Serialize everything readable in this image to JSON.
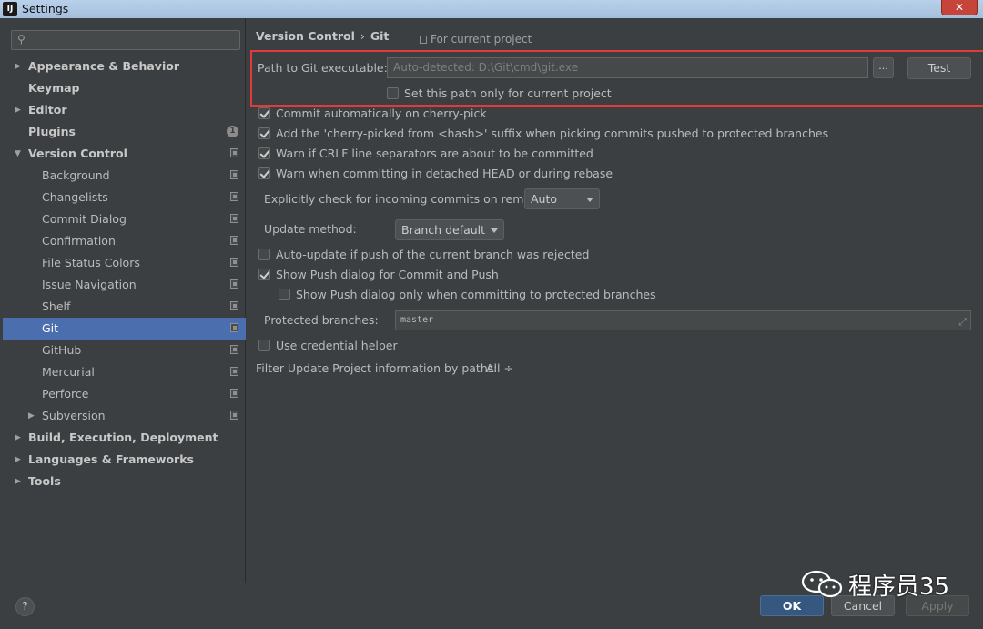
{
  "window": {
    "title": "Settings",
    "app_icon": "IJ",
    "close_glyph": "✕"
  },
  "search": {
    "placeholder": "",
    "icon": "search-icon"
  },
  "sidebar": {
    "items": [
      {
        "label": "Appearance & Behavior",
        "level": 0,
        "expandable": true,
        "expanded": false,
        "bold": true
      },
      {
        "label": "Keymap",
        "level": 0,
        "bold": true
      },
      {
        "label": "Editor",
        "level": 0,
        "expandable": true,
        "expanded": false,
        "bold": true
      },
      {
        "label": "Plugins",
        "level": 0,
        "bold": true,
        "badge": "1"
      },
      {
        "label": "Version Control",
        "level": 0,
        "expandable": true,
        "expanded": true,
        "bold": true
      },
      {
        "label": "Background",
        "level": 1
      },
      {
        "label": "Changelists",
        "level": 1
      },
      {
        "label": "Commit Dialog",
        "level": 1
      },
      {
        "label": "Confirmation",
        "level": 1
      },
      {
        "label": "File Status Colors",
        "level": 1
      },
      {
        "label": "Issue Navigation",
        "level": 1
      },
      {
        "label": "Shelf",
        "level": 1
      },
      {
        "label": "Git",
        "level": 1,
        "selected": true
      },
      {
        "label": "GitHub",
        "level": 1
      },
      {
        "label": "Mercurial",
        "level": 1
      },
      {
        "label": "Perforce",
        "level": 1
      },
      {
        "label": "Subversion",
        "level": 1,
        "expandable": true,
        "expanded": false
      },
      {
        "label": "Build, Execution, Deployment",
        "level": 0,
        "expandable": true,
        "expanded": false,
        "bold": true
      },
      {
        "label": "Languages & Frameworks",
        "level": 0,
        "expandable": true,
        "expanded": false,
        "bold": true
      },
      {
        "label": "Tools",
        "level": 0,
        "expandable": true,
        "expanded": false,
        "bold": true
      }
    ]
  },
  "main": {
    "breadcrumb": {
      "parent": "Version Control",
      "separator": "›",
      "current": "Git"
    },
    "scope_note": "For current project",
    "git_path": {
      "label": "Path to Git executable:",
      "placeholder": "Auto-detected: D:\\Git\\cmd\\git.exe",
      "browse_label": "...",
      "test_label": "Test",
      "only_current_label": "Set this path only for current project",
      "only_current_checked": false
    },
    "checkboxes_top": [
      {
        "label": "Commit automatically on cherry-pick",
        "checked": true
      },
      {
        "label": "Add the 'cherry-picked from <hash>' suffix when picking commits pushed to protected branches",
        "checked": true
      },
      {
        "label": "Warn if CRLF line separators are about to be committed",
        "checked": true
      },
      {
        "label": "Warn when committing in detached HEAD or during rebase",
        "checked": true
      }
    ],
    "incoming_check": {
      "label": "Explicitly check for incoming commits on remotes:",
      "value": "Auto"
    },
    "update_method": {
      "label": "Update method:",
      "value": "Branch default"
    },
    "checkboxes_bottom": [
      {
        "label": "Auto-update if push of the current branch was rejected",
        "checked": false
      },
      {
        "label": "Show Push dialog for Commit and Push",
        "checked": true
      },
      {
        "label": "Show Push dialog only when committing to protected branches",
        "checked": false,
        "indent": true
      }
    ],
    "protected_branches": {
      "label": "Protected branches:",
      "value": "master",
      "expand_glyph": "⤢"
    },
    "credential_helper": {
      "label": "Use credential helper",
      "checked": false
    },
    "filter_paths": {
      "label": "Filter Update Project information by paths:",
      "value": "All ÷"
    }
  },
  "footer": {
    "help_label": "?",
    "ok_label": "OK",
    "cancel_label": "Cancel",
    "apply_label": "Apply"
  },
  "watermark": {
    "text": "程序员35",
    "logo": "wechat-logo"
  },
  "colors": {
    "background": "#3c3f41",
    "selection": "#4b6eaf",
    "highlight_frame": "#e03a3a",
    "ok_button": "#365880"
  }
}
